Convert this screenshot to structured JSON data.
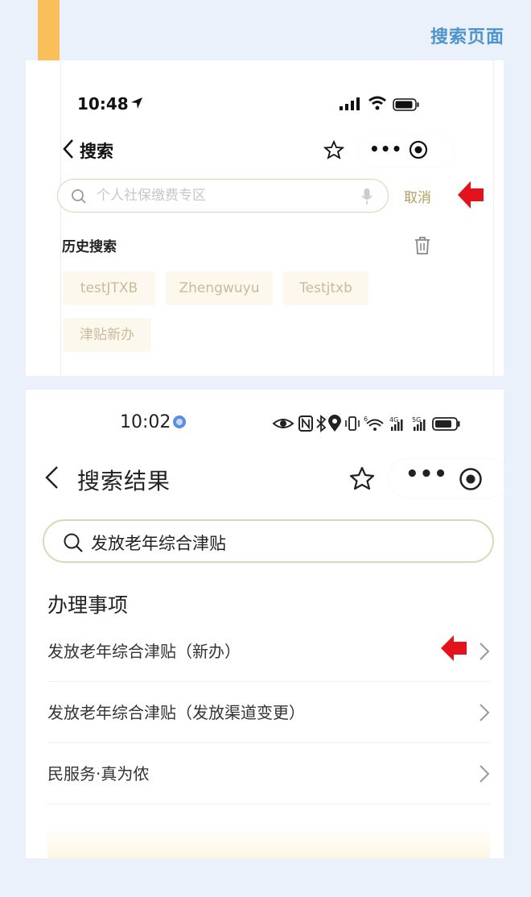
{
  "page_title": "搜索页面",
  "panel1": {
    "status_time": "10:48",
    "nav_title": "搜索",
    "search_placeholder": "个人社保缴费专区",
    "cancel_label": "取消",
    "history_title": "历史搜索",
    "history_chips": [
      "testJTXB",
      "Zhengwuyu",
      "Testjtxb",
      "津贴新办"
    ]
  },
  "panel2": {
    "status_time": "10:02",
    "nav_title": "搜索结果",
    "search_value": "发放老年综合津贴",
    "section_title": "办理事项",
    "items": [
      {
        "label": "发放老年综合津贴（新办）"
      },
      {
        "label": "发放老年综合津贴（发放渠道变更）"
      },
      {
        "label": "民服务·真为侬"
      }
    ]
  },
  "colors": {
    "accent_gold": "#b59b5f",
    "arrow_red": "#e3131d",
    "ribbon": "#f8bf5a",
    "title_blue": "#4f93cf",
    "background": "#eaf1fa"
  },
  "icons": [
    "bookmark-ribbon",
    "location-arrow-icon",
    "signal-icon",
    "wifi-icon",
    "battery-icon",
    "back-chevron-icon",
    "star-icon",
    "more-dots-icon",
    "target-icon",
    "search-icon",
    "mic-icon",
    "red-arrow-icon",
    "trash-icon",
    "chevron-right-icon"
  ]
}
